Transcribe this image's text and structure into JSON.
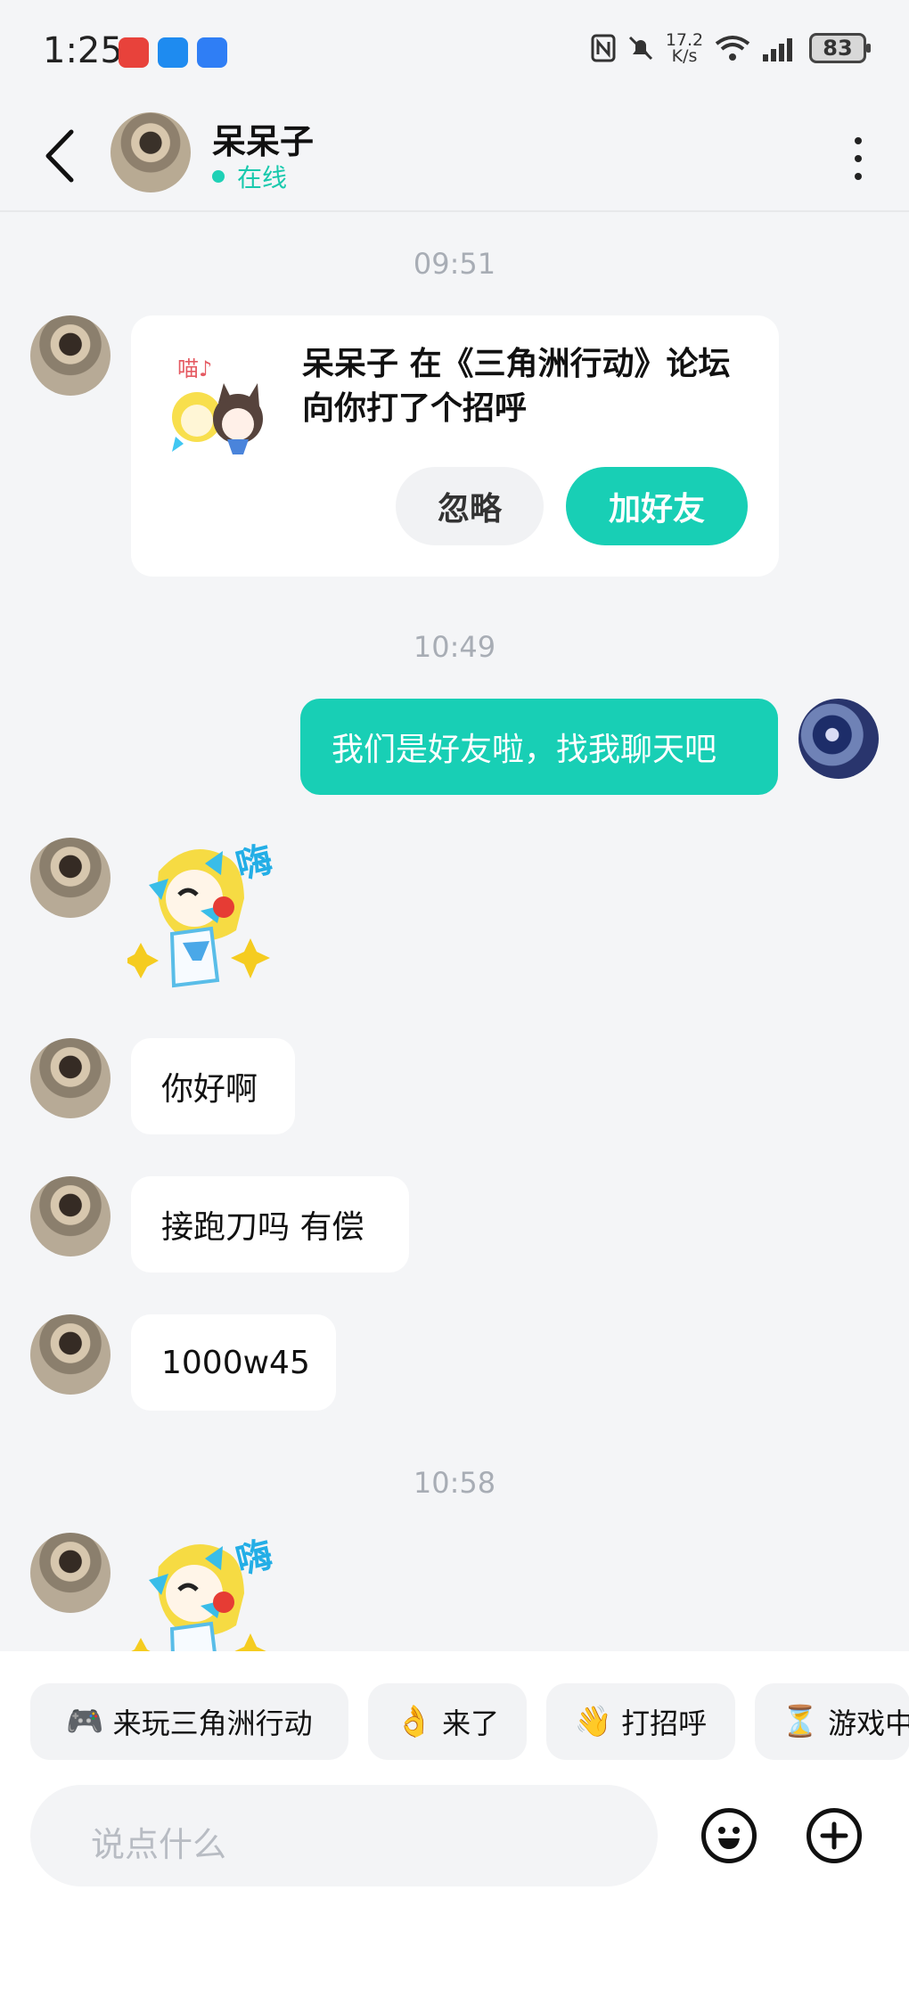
{
  "status_bar": {
    "time": "1:25",
    "network_speed": "17.2\nK/s",
    "battery": "83"
  },
  "header": {
    "contact_name": "呆呆子",
    "status": "在线"
  },
  "chat": {
    "timestamps": [
      "09:51",
      "10:49",
      "10:58"
    ],
    "greeting_card": {
      "text": "呆呆子 在《三角洲行动》论坛向你打了个招呼",
      "ignore_label": "忽略",
      "add_label": "加好友"
    },
    "messages": [
      {
        "from": "me",
        "text": "我们是好友啦，找我聊天吧"
      },
      {
        "from": "other",
        "text": "你好啊"
      },
      {
        "from": "other",
        "text": "接跑刀吗 有偿"
      },
      {
        "from": "other",
        "text": "1000w45"
      }
    ],
    "sticker_text": "嗨",
    "sticker_small_text": "喵♪"
  },
  "quick_replies": [
    {
      "emoji": "🎮",
      "label": "来玩三角洲行动"
    },
    {
      "emoji": "👌",
      "label": "来了"
    },
    {
      "emoji": "👋",
      "label": "打招呼"
    },
    {
      "emoji": "⏳",
      "label": "游戏中"
    }
  ],
  "input": {
    "placeholder": "说点什么"
  },
  "icons": [
    "back-icon",
    "more-icon",
    "emoji-icon",
    "plus-icon"
  ],
  "colors": {
    "accent": "#18cfb5",
    "background": "#f4f5f7",
    "bubble": "#ffffff"
  }
}
